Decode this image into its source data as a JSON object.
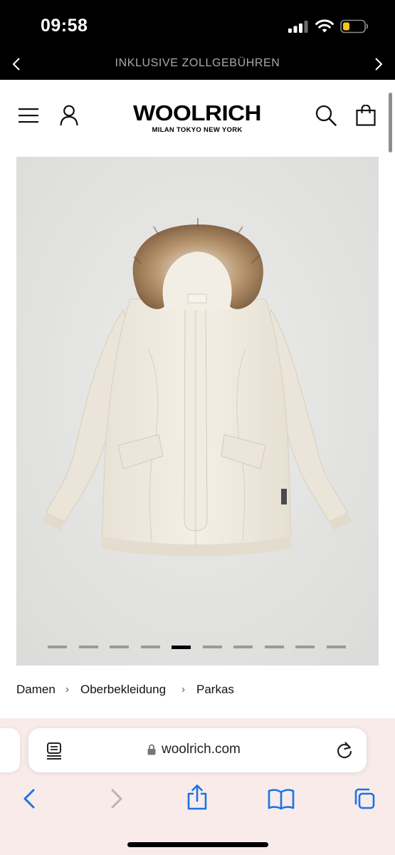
{
  "status_bar": {
    "time": "09:58",
    "icons": [
      "cellular-signal-icon",
      "wifi-icon",
      "battery-low-icon"
    ],
    "battery_color": "#f5c518"
  },
  "promo_banner": {
    "text": "INKLUSIVE ZOLLGEBÜHREN",
    "icons": [
      "chevron-left-icon",
      "chevron-right-icon"
    ]
  },
  "header": {
    "logo_main": "WOOLRICH",
    "logo_sub": "MILAN TOKYO NEW YORK",
    "icons": [
      "hamburger-menu-icon",
      "account-icon",
      "search-icon",
      "shopping-bag-icon"
    ]
  },
  "product_gallery": {
    "image": "cream-parka-with-fur-hood",
    "slide_count": 10,
    "active_slide": 5
  },
  "breadcrumb": {
    "items": [
      "Damen",
      "Oberbekleidung",
      "Parkas"
    ],
    "separator": "›"
  },
  "safari": {
    "url": "woolrich.com",
    "icons": [
      "reader-mode-icon",
      "lock-icon",
      "reload-icon",
      "back-icon",
      "forward-icon",
      "share-icon",
      "bookmarks-icon",
      "tabs-icon"
    ],
    "accent_color": "#1a73e8",
    "bar_color": "#f8ebe9"
  }
}
